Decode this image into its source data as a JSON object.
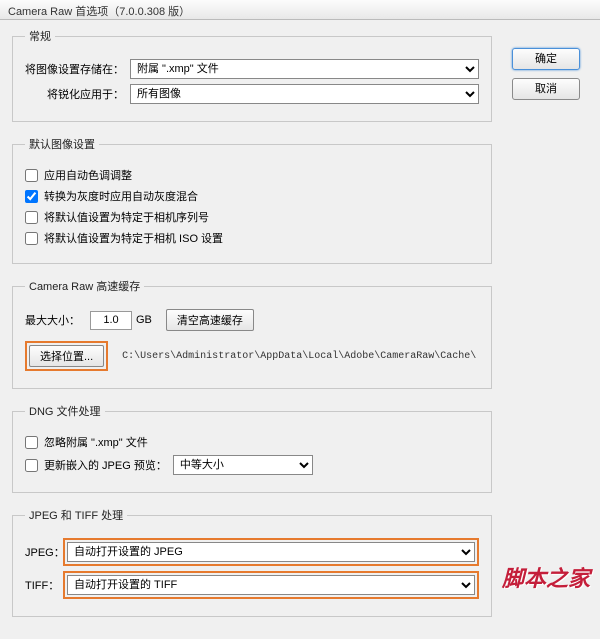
{
  "window": {
    "title": "Camera Raw 首选项（7.0.0.308 版）"
  },
  "buttons": {
    "ok": "确定",
    "cancel": "取消"
  },
  "general": {
    "legend": "常规",
    "saveLabel": "将图像设置存储在：",
    "saveValue": "附属 \".xmp\" 文件",
    "sharpLabel": "将锐化应用于：",
    "sharpValue": "所有图像"
  },
  "defaults": {
    "legend": "默认图像设置",
    "cb1": "应用自动色调调整",
    "cb2": "转换为灰度时应用自动灰度混合",
    "cb3": "将默认值设置为特定于相机序列号",
    "cb4": "将默认值设置为特定于相机 ISO 设置"
  },
  "cache": {
    "legend": "Camera Raw 高速缓存",
    "maxLabel": "最大大小：",
    "maxValue": "1.0",
    "gb": "GB",
    "purge": "清空高速缓存",
    "select": "选择位置...",
    "path": "C:\\Users\\Administrator\\AppData\\Local\\Adobe\\CameraRaw\\Cache\\"
  },
  "dng": {
    "legend": "DNG 文件处理",
    "ignore": "忽略附属 \".xmp\" 文件",
    "update": "更新嵌入的 JPEG 预览：",
    "size": "中等大小"
  },
  "jt": {
    "legend": "JPEG 和 TIFF 处理",
    "jpegLabel": "JPEG：",
    "jpegValue": "自动打开设置的 JPEG",
    "tiffLabel": "TIFF：",
    "tiffValue": "自动打开设置的 TIFF"
  },
  "watermark": "脚本之家"
}
